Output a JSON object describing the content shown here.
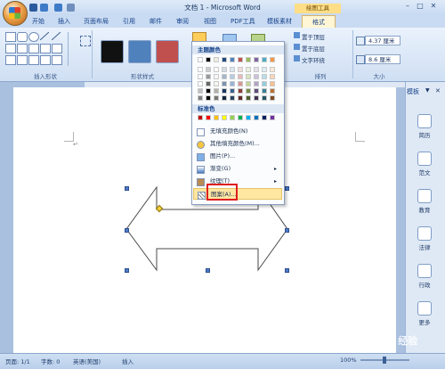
{
  "window": {
    "title": "文档 1 - Microsoft Word",
    "context_tab_group": "绘图工具",
    "controls": [
      "–",
      "□",
      "✕"
    ]
  },
  "tabs": [
    "开始",
    "插入",
    "页面布局",
    "引用",
    "邮件",
    "审阅",
    "视图",
    "PDF工具",
    "模板素材",
    "格式"
  ],
  "ribbon": {
    "groups": [
      "插入形状",
      "形状样式",
      "排列",
      "大小"
    ],
    "arrange_buttons": [
      "置于顶层",
      "置于底层",
      "文字环绕"
    ],
    "size": {
      "height": "4.37 厘米",
      "width": "8.6 厘米"
    },
    "style_colors": [
      "#111111",
      "#4f81bd",
      "#c0504d"
    ]
  },
  "menu": {
    "theme_header": "主题颜色",
    "standard_header": "标准色",
    "items": [
      {
        "label": "无填充颜色(N)",
        "icon": "no-fill-icon",
        "arrow": ""
      },
      {
        "label": "其他填充颜色(M)...",
        "icon": "palette-icon",
        "arrow": ""
      },
      {
        "label": "图片(P)...",
        "icon": "picture-icon",
        "arrow": ""
      },
      {
        "label": "渐变(G)",
        "icon": "gradient-icon",
        "arrow": "▸"
      },
      {
        "label": "纹理(T)",
        "icon": "texture-icon",
        "arrow": "▸"
      },
      {
        "label": "图案(A)...",
        "icon": "pattern-icon",
        "arrow": ""
      }
    ],
    "theme_top_row": [
      "#ffffff",
      "#000000",
      "#eeece1",
      "#1f497d",
      "#4f81bd",
      "#c0504d",
      "#9bbb59",
      "#8064a2",
      "#4bacc6",
      "#f79646"
    ],
    "standard_colors": [
      "#c00000",
      "#ff0000",
      "#ffc000",
      "#ffff00",
      "#92d050",
      "#00b050",
      "#00b0f0",
      "#0070c0",
      "#002060",
      "#7030a0"
    ]
  },
  "panel": {
    "title": "模板",
    "items": [
      "简历",
      "范文",
      "教育",
      "法律",
      "行政",
      "更多"
    ]
  },
  "status": {
    "page": "页面: 1/1",
    "words": "字数: 0",
    "language": "英语(美国)",
    "mode": "插入",
    "zoom": "100%"
  },
  "watermark": "Baidu 经验"
}
